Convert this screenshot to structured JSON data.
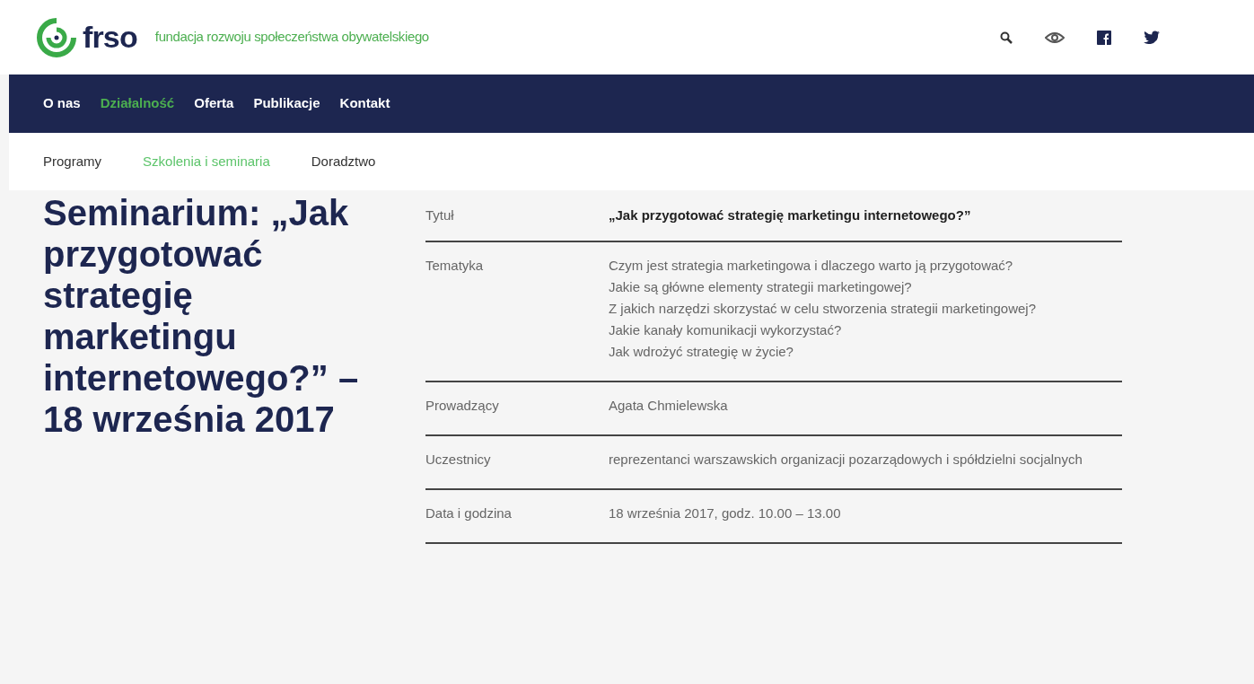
{
  "header": {
    "logo": "frso",
    "tagline": "fundacja rozwoju społeczeństwa obywatelskiego"
  },
  "main_nav": [
    {
      "label": "O nas",
      "selected": false
    },
    {
      "label": "Działalność",
      "selected": true
    },
    {
      "label": "Oferta",
      "selected": false
    },
    {
      "label": "Publikacje",
      "selected": false
    },
    {
      "label": "Kontakt",
      "selected": false
    }
  ],
  "sub_nav": [
    {
      "label": "Programy",
      "selected": false
    },
    {
      "label": "Szkolenia i seminaria",
      "selected": true
    },
    {
      "label": "Doradztwo",
      "selected": false
    }
  ],
  "page_title": "Seminarium: „Jak przygotować strategię marketingu internetowego?” – 18 września 2017",
  "details": [
    {
      "label": "Tytuł",
      "kind": "title",
      "lines": [
        "„Jak przygotować strategię marketingu internetowego?”"
      ]
    },
    {
      "label": "Tematyka",
      "kind": "text",
      "lines": [
        "Czym jest strategia marketingowa i dlaczego warto ją przygotować?",
        "Jakie są główne elementy strategii marketingowej?",
        "Z jakich narzędzi skorzystać w celu stworzenia strategii marketingowej?",
        "Jakie kanały komunikacji wykorzystać?",
        "Jak wdrożyć strategię w życie?"
      ]
    },
    {
      "label": "Prowadzący",
      "kind": "text",
      "lines": [
        "Agata Chmielewska"
      ]
    },
    {
      "label": "Uczestnicy",
      "kind": "text",
      "lines": [
        "reprezentanci warszawskich organizacji pozarządowych i spółdzielni socjalnych"
      ]
    },
    {
      "label": "Data i godzina",
      "kind": "text",
      "lines": [
        "18 września 2017, godz. 10.00 – 13.00"
      ]
    }
  ]
}
